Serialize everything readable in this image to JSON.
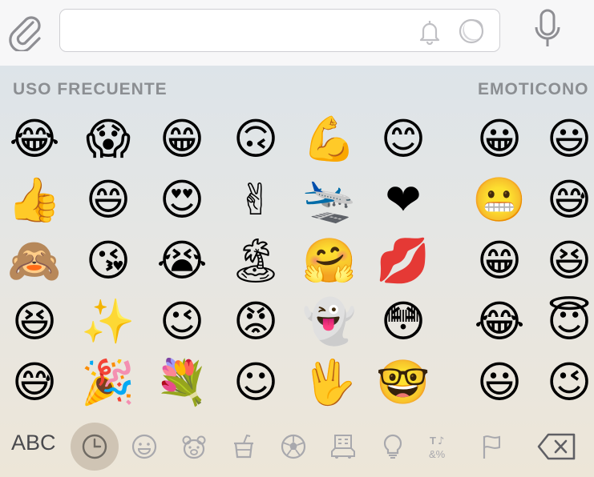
{
  "input": {
    "value": "",
    "placeholder": ""
  },
  "sections": {
    "frequent": "USO FRECUENTE",
    "emoticons": "EMOTICONO"
  },
  "frequent_emojis": [
    [
      "😂",
      "😱",
      "😁",
      "🙃",
      "💪",
      "😊"
    ],
    [
      "👍",
      "😄",
      "😍",
      "✌",
      "🛬",
      "❤"
    ],
    [
      "🙈",
      "😘",
      "😭",
      "🏝",
      "🤗",
      "💋"
    ],
    [
      "😆",
      "✨",
      "😉",
      "😡",
      "👻",
      "😳"
    ],
    [
      "😅",
      "🎉",
      "💐",
      "☺",
      "🖖",
      "🤓"
    ]
  ],
  "emoticon_emojis": [
    [
      "😀",
      "😃"
    ],
    [
      "😬",
      "😅"
    ],
    [
      "😁",
      "😆"
    ],
    [
      "😂",
      "😇"
    ],
    [
      "😃",
      "😉"
    ]
  ],
  "bottom_bar": {
    "abc_label": "ABC",
    "categories": [
      "recent",
      "smileys",
      "animals",
      "food",
      "activity",
      "travel",
      "objects",
      "symbols",
      "flags"
    ],
    "selected": "recent"
  },
  "colors": {
    "icon_gray": "#8e8e93",
    "title_gray": "#8b8e92",
    "selected_bg": "#cfc4b4"
  }
}
